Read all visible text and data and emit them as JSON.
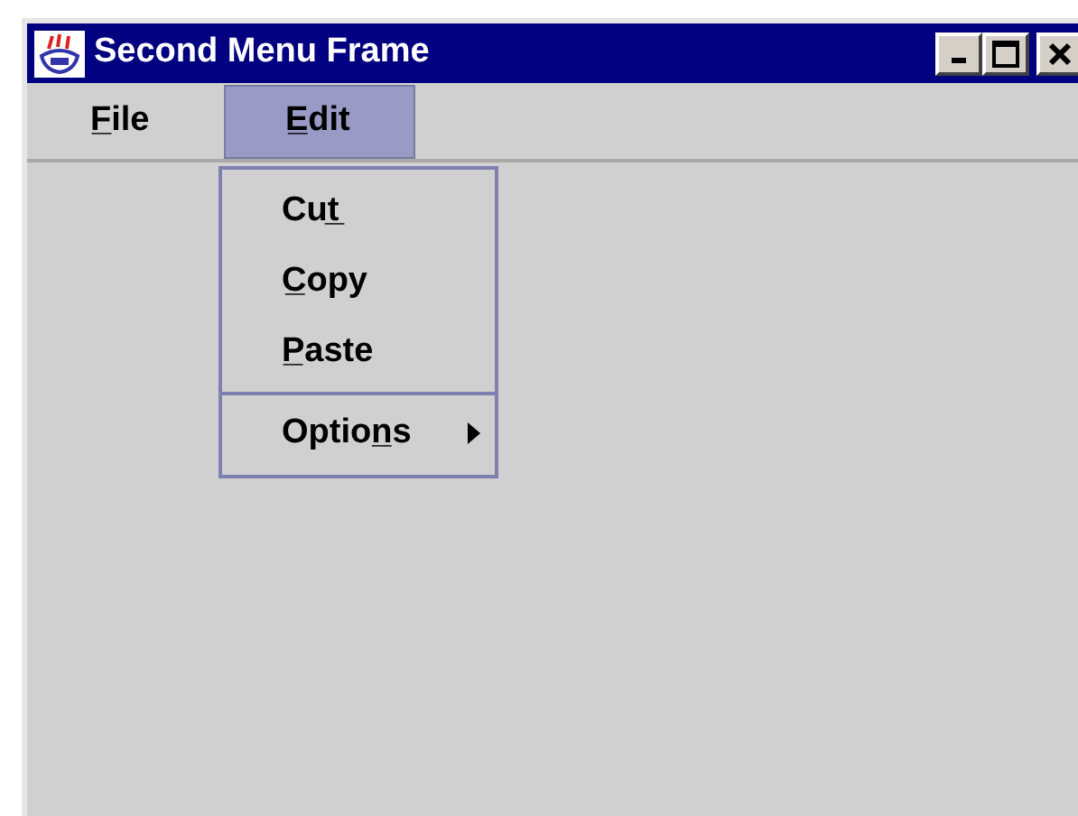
{
  "window": {
    "title": "Second Menu Frame"
  },
  "menu_bar": [
    {
      "label": "F̲ile",
      "selected": false
    },
    {
      "label": "E̲dit",
      "selected": true
    }
  ],
  "menu": {
    "items": [
      {
        "kind": "item",
        "label": "Cut̲"
      },
      {
        "kind": "item",
        "label": "C̲opy"
      },
      {
        "kind": "item",
        "label": "P̲aste"
      },
      {
        "kind": "separator"
      },
      {
        "kind": "submenu",
        "label": "Option̲s"
      }
    ]
  }
}
